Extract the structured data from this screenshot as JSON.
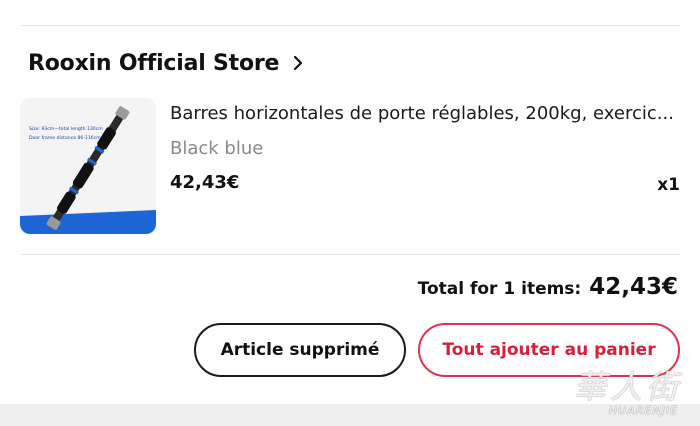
{
  "store": {
    "name": "Rooxin Official Store",
    "chevron_icon": "chevron-right-icon"
  },
  "product": {
    "title": "Barres horizontales de porte réglables, 200kg, exercic...",
    "variant": "Black blue",
    "price": "42,43€",
    "quantity": "x1",
    "image": {
      "caption_line1": "Size: 93cm—total length 130cm",
      "caption_line2": "Door frame distance 86-116cm",
      "accent_color": "#1e66d6"
    }
  },
  "summary": {
    "total_label": "Total for 1 items:",
    "total_value": "42,43€"
  },
  "actions": {
    "removed_label": "Article supprimé",
    "add_all_label": "Tout ajouter au panier",
    "add_all_color": "#d61f3a"
  },
  "watermark": {
    "cjk": "華人街",
    "latin": "HUARENJIE"
  }
}
